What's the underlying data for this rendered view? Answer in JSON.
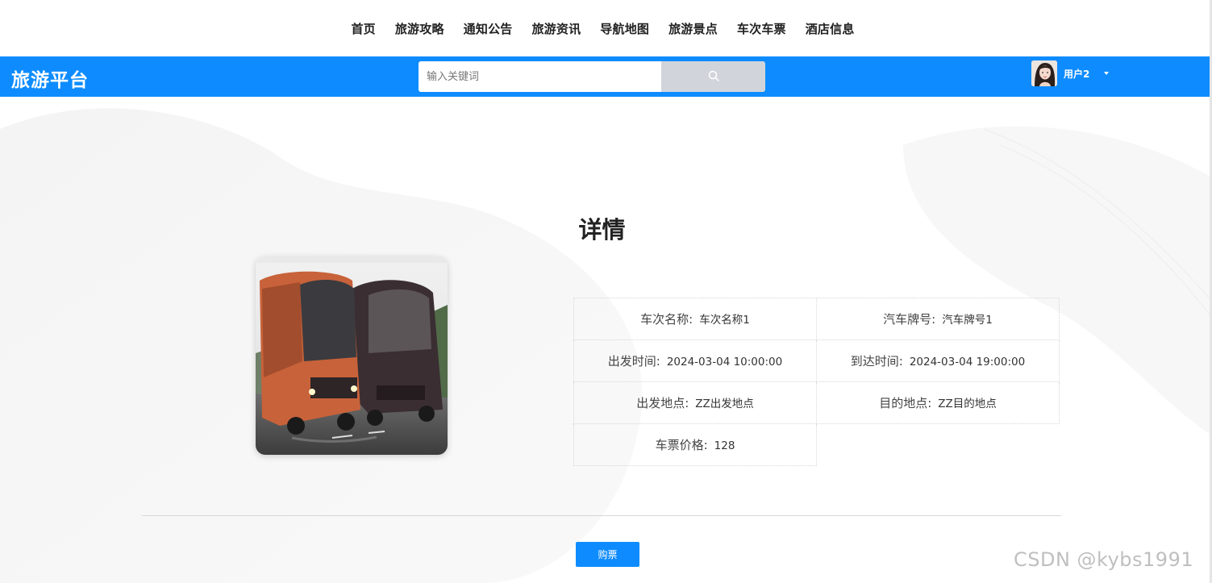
{
  "topnav": {
    "items": [
      "首页",
      "旅游攻略",
      "通知公告",
      "旅游资讯",
      "导航地图",
      "旅游景点",
      "车次车票",
      "酒店信息"
    ]
  },
  "header": {
    "brand": "旅游平台",
    "search": {
      "placeholder": "输入关键词",
      "value": ""
    },
    "user": {
      "name": "用户2"
    }
  },
  "detail": {
    "title": "详情",
    "fields": [
      {
        "label": "车次名称:",
        "value": "车次名称1"
      },
      {
        "label": "汽车牌号:",
        "value": "汽车牌号1"
      },
      {
        "label": "出发时间:",
        "value": "2024-03-04 10:00:00"
      },
      {
        "label": "到达时间:",
        "value": "2024-03-04 19:00:00"
      },
      {
        "label": "出发地点:",
        "value": "ZZ出发地点"
      },
      {
        "label": "目的地点:",
        "value": "ZZ目的地点"
      },
      {
        "label": "车票价格:",
        "value": "128"
      }
    ],
    "buy_label": "购票"
  },
  "watermark": "CSDN @kybs1991",
  "colors": {
    "accent": "#0e8cff",
    "search_button": "#d1d5db"
  },
  "icons": {
    "search": "search-icon",
    "caret": "chevron-down-icon"
  }
}
